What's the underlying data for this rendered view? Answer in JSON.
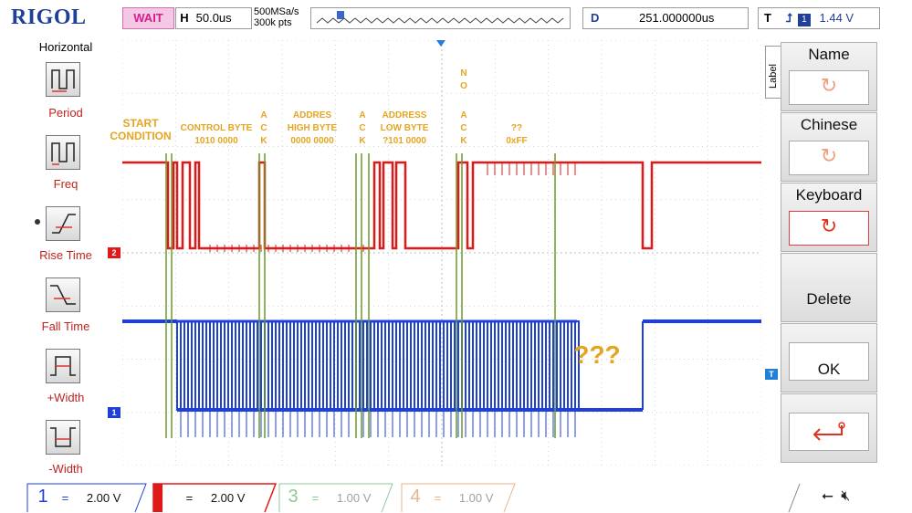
{
  "header": {
    "brand": "RIGOL",
    "run_state": "WAIT",
    "timebase_label": "H",
    "timebase_value": "50.0us",
    "sample_rate": "500MSa/s",
    "memory_depth": "300k pts",
    "delay_label": "D",
    "delay_value": "251.000000us",
    "trigger_label": "T",
    "trigger_source": "1",
    "trigger_level": "1.44 V"
  },
  "left_menu": {
    "title": "Horizontal",
    "items": [
      {
        "label": "Period",
        "active": true
      },
      {
        "label": "Freq",
        "active": false
      },
      {
        "label": "Rise Time",
        "active": false
      },
      {
        "label": "Fall Time",
        "active": false
      },
      {
        "label": "+Width",
        "active": false
      },
      {
        "label": "-Width",
        "active": false
      }
    ]
  },
  "right_menu": {
    "tab_label": "Label",
    "items": [
      {
        "label": "Name"
      },
      {
        "label": "Chinese"
      },
      {
        "label": "Keyboard"
      },
      {
        "label": "Delete"
      },
      {
        "label": "OK"
      },
      {
        "label": ""
      }
    ]
  },
  "annotations": {
    "start": [
      "START",
      "CONDITION"
    ],
    "control": [
      "CONTROL BYTE",
      "1010 0000"
    ],
    "ack1": [
      "A",
      "C",
      "K"
    ],
    "addr_high": [
      "ADDRES",
      "HIGH BYTE",
      "0000 0000"
    ],
    "ack2": [
      "A",
      "C",
      "K"
    ],
    "addr_low": [
      "ADDRESS",
      "LOW BYTE",
      "?101 0000"
    ],
    "nack": [
      "N",
      "O",
      "A",
      "C",
      "K"
    ],
    "data": [
      "??",
      "0xFF"
    ],
    "question": "???"
  },
  "channels": [
    {
      "num": "1",
      "scale": "2.00 V",
      "color": "#1f3fd9",
      "active": false
    },
    {
      "num": "2",
      "scale": "2.00 V",
      "color": "#e01818",
      "active": true
    },
    {
      "num": "3",
      "scale": "1.00 V",
      "color": "#8fc79a",
      "active": false
    },
    {
      "num": "4",
      "scale": "1.00 V",
      "color": "#e9b48a",
      "active": false
    }
  ],
  "markers": {
    "ch1": "1",
    "ch2": "2",
    "trigger": "T"
  },
  "colors": {
    "accent": "#1f3f99",
    "ch1": "#1f3fd9",
    "ch2": "#e01818",
    "annotation": "#e5a520",
    "cursor": "#6a9c2a"
  },
  "status_icons": [
    "usb-icon",
    "speaker-muted-icon"
  ]
}
